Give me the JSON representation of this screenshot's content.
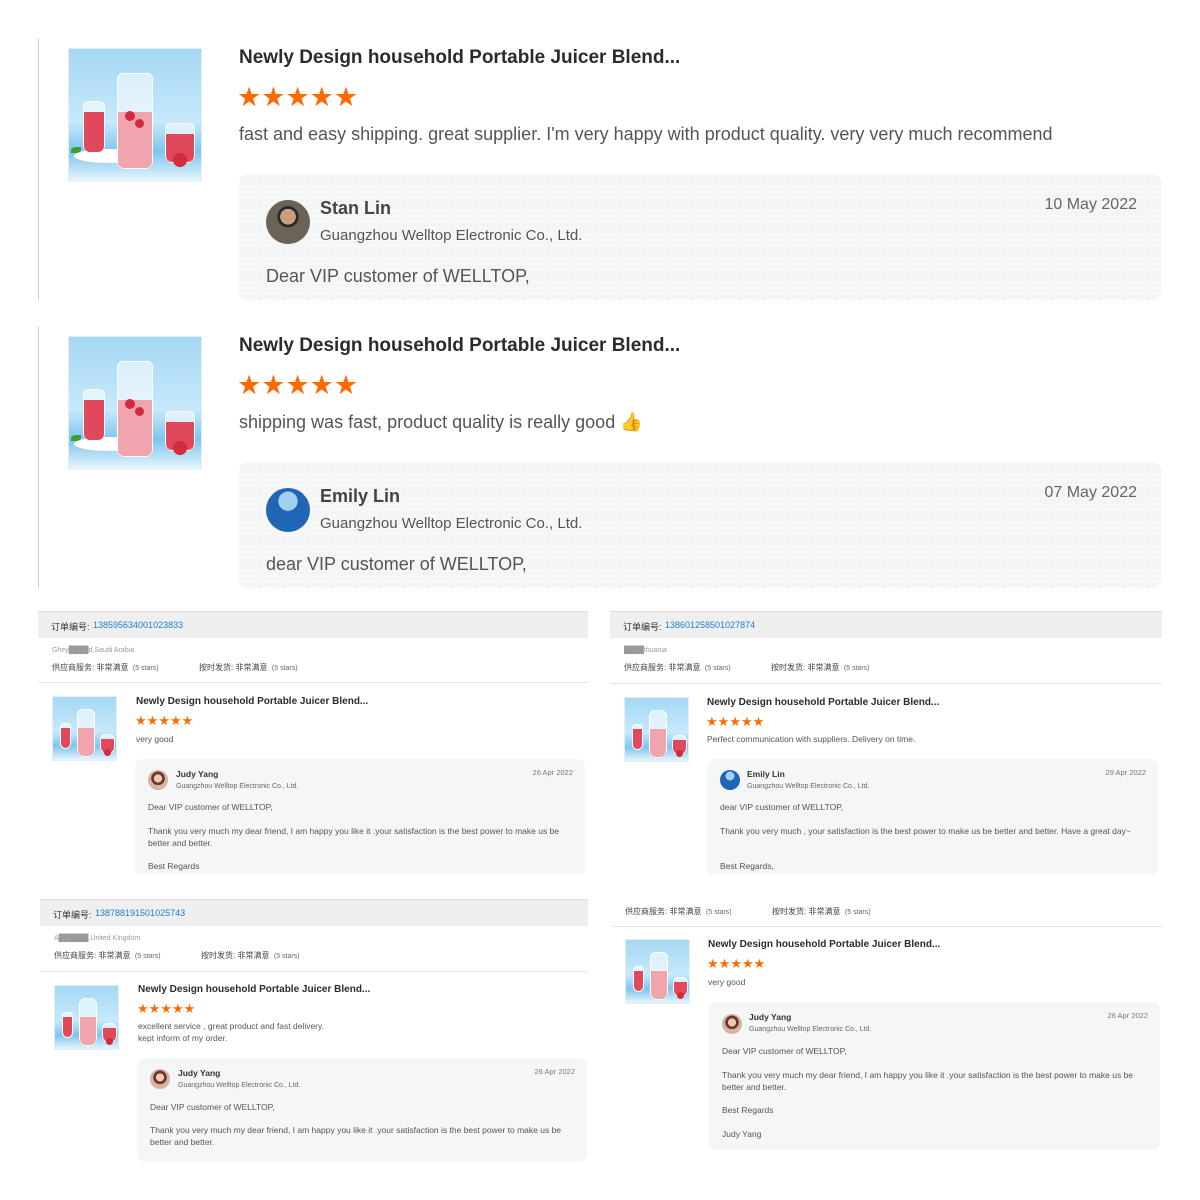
{
  "colors": {
    "star": "#ff6a00",
    "link": "#1a7fd4",
    "reply_bg": "#f5f6f8"
  },
  "big_reviews": [
    {
      "product_title": "Newly Design household Portable Juicer Blend...",
      "rating": 5,
      "review_text": "fast and easy shipping. great supplier. I'm very happy with product quality. very very much recommend",
      "reply": {
        "name": "Stan Lin",
        "company": "Guangzhou Welltop Electronic Co., Ltd.",
        "date": "10 May 2022",
        "text": "Dear VIP customer of WELLTOP,"
      }
    },
    {
      "product_title": "Newly Design household Portable Juicer Blend...",
      "rating": 5,
      "review_text": "shipping was fast, product quality is really good 👍",
      "reply": {
        "name": "Emily Lin",
        "company": "Guangzhou Welltop Electronic Co., Ltd.",
        "date": "07 May 2022",
        "text": "dear VIP customer of WELLTOP,"
      }
    }
  ],
  "panels": [
    {
      "order_label": "订单编号:",
      "order_number": "138595634001023833",
      "buyer": "Ghey████d,Saudi Arabia",
      "supplier_service": "供应商服务: 非常满意",
      "supplier_stars": "(5 stars)",
      "on_time": "按时发货: 非常满意",
      "on_time_stars": "(5 stars)",
      "product_title": "Newly Design household Portable Juicer Blend...",
      "rating": 5,
      "review_text": "very good",
      "reply": {
        "name": "Judy Yang",
        "company": "Guangzhou Welltop Electronic Co., Ltd.",
        "date": "26 Apr 2022",
        "greeting": "Dear VIP customer of WELLTOP,",
        "body": "Thank you very much my dear friend, I am happy you like it .your satisfaction is the best power to make us be better and better.",
        "closing": "Best Regards"
      }
    },
    {
      "order_label": "订单编号:",
      "order_number": "138601258501027874",
      "buyer": "████thuania",
      "supplier_service": "供应商服务: 非常满意",
      "supplier_stars": "(5 stars)",
      "on_time": "按时发货: 非常满意",
      "on_time_stars": "(5 stars)",
      "product_title": "Newly Design household Portable Juicer Blend...",
      "rating": 5,
      "review_text": "Perfect communication with suppliers. Delivery on time.",
      "reply": {
        "name": "Emily Lin",
        "company": "Guangzhou Welltop Electronic Co., Ltd.",
        "date": "29 Apr 2022",
        "greeting": "dear VIP customer of WELLTOP,",
        "body": "Thank you very much  , your satisfaction is the best power to make us be better and better. Have a great day~",
        "closing": "Best Regards,"
      }
    },
    {
      "order_label": "订单编号:",
      "order_number": "138788191501025743",
      "buyer": "A██████,United Kingdom",
      "supplier_service": "供应商服务: 非常满意",
      "supplier_stars": "(5 stars)",
      "on_time": "按时发货: 非常满意",
      "on_time_stars": "(5 stars)",
      "product_title": "Newly Design household Portable Juicer Blend...",
      "rating": 5,
      "review_text": "excellent service , great  product and fast delivery.",
      "review_text_2": "kept inform of my order.",
      "reply": {
        "name": "Judy Yang",
        "company": "Guangzhou Welltop Electronic Co., Ltd.",
        "date": "26 Apr 2022",
        "greeting": "Dear VIP customer of WELLTOP,",
        "body": "Thank you very much my dear friend, I am happy you like it .your satisfaction is the best power to make us be better and better."
      }
    },
    {
      "supplier_service": "供应商服务: 非常满意",
      "supplier_stars": "(5 stars)",
      "on_time": "按时发货: 非常满意",
      "on_time_stars": "(5 stars)",
      "product_title": "Newly Design household Portable Juicer Blend...",
      "rating": 5,
      "review_text": "very good",
      "reply": {
        "name": "Judy Yang",
        "company": "Guangzhou Welltop Electronic Co., Ltd.",
        "date": "26 Apr 2022",
        "greeting": "Dear VIP customer of WELLTOP,",
        "body": "Thank you very much my dear friend, I am happy you like it .your satisfaction is the best power to make us be better and better.",
        "closing": "Best Regards",
        "signature": "Judy Yang"
      }
    }
  ]
}
